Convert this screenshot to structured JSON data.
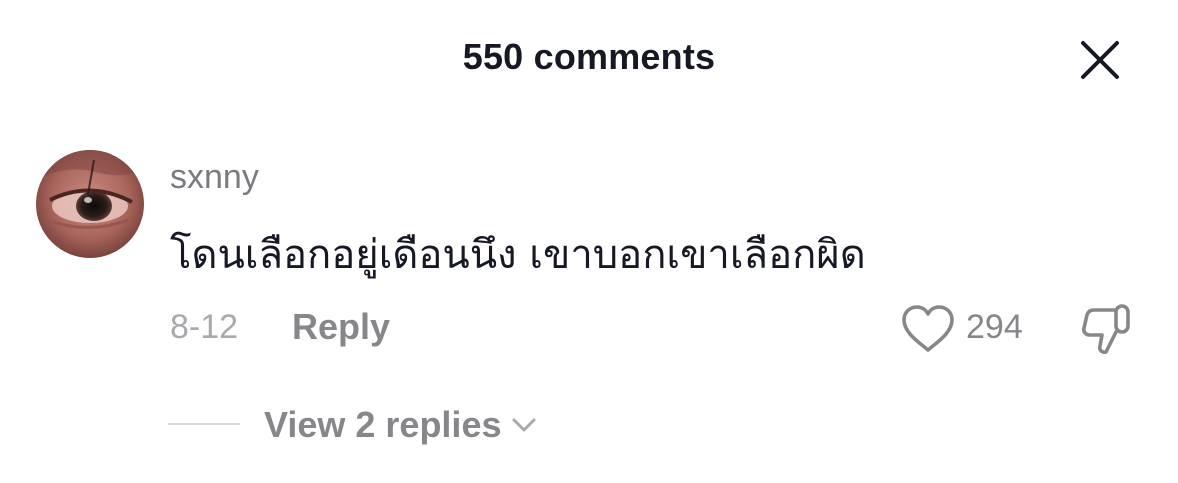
{
  "header": {
    "title": "550 comments",
    "close_icon": "close-icon"
  },
  "comment": {
    "username": "sxnny",
    "text": "โดนเลือกอยู่เดือนนึง เขาบอกเขาเลือกผิด",
    "date": "8-12",
    "reply_label": "Reply",
    "like_count": "294",
    "like_icon": "heart-outline-icon",
    "dislike_icon": "thumbs-down-icon",
    "avatar_icon": "avatar"
  },
  "replies": {
    "label": "View 2 replies",
    "icon": "chevron-down-icon"
  },
  "colors": {
    "text_primary": "#161823",
    "text_secondary": "#86878b",
    "text_tertiary": "#a8a9ad"
  }
}
